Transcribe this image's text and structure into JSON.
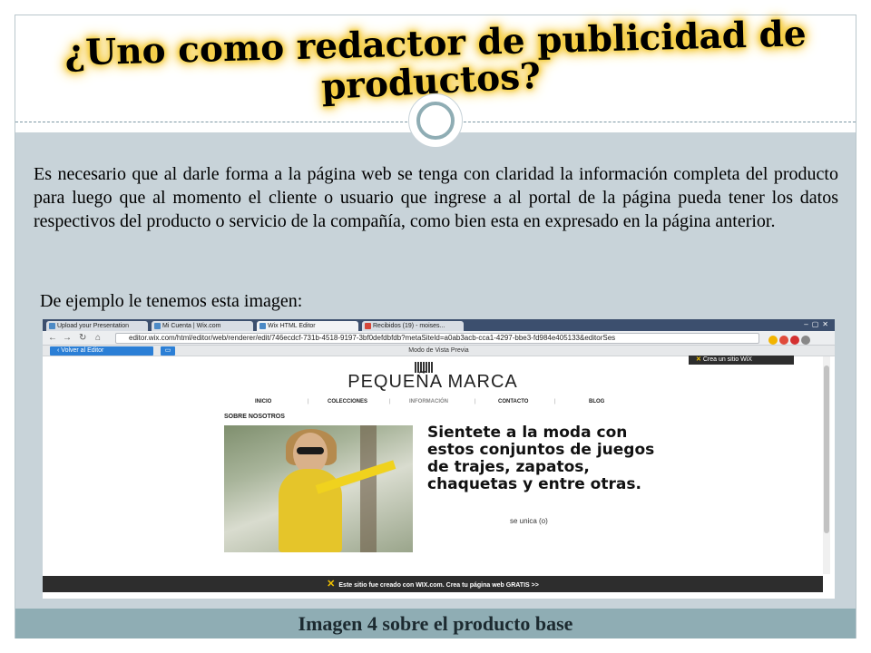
{
  "slide": {
    "title_line1": "¿Uno como redactor de publicidad de",
    "title_line2": "productos?",
    "paragraph": "Es necesario que al darle forma a la página web se tenga con claridad la información completa del producto para luego que al momento el cliente o usuario que ingrese a al portal de la página pueda tener los datos respectivos del producto o servicio de la compañía, como bien esta en expresado en la página anterior.",
    "example_label": "De ejemplo le tenemos esta imagen:",
    "caption": "Imagen 4 sobre el producto base"
  },
  "browser": {
    "tabs": [
      {
        "label": "Upload your Presentation"
      },
      {
        "label": "Mi Cuenta | Wix.com"
      },
      {
        "label": "Wix HTML Editor"
      },
      {
        "label": "Recibidos (19) - moises..."
      }
    ],
    "url": "editor.wix.com/html/editor/web/renderer/edit/746ecdcf-731b-4518-9197-3bf0defdbfdb?metaSiteId=a0ab3acb-cca1-4297-bbe3-fd984e405133&editorSes",
    "back_label": "Volver al Editor",
    "preview_mode": "Modo de Vista Previa",
    "wix_badge": "Crea un sitio WiX",
    "footer": "Este sitio fue creado con WIX.com. Crea tu página web GRATIS >>"
  },
  "site": {
    "brand": "PEQUEÑA MARCA",
    "nav": [
      "INICIO",
      "COLECCIONES",
      "INFORMACIÓN",
      "CONTACTO",
      "BLOG"
    ],
    "about_title": "SOBRE NOSOTROS",
    "promo_text": "Sientete a la moda con estos conjuntos de juegos de trajes, zapatos, chaquetas y entre otras.",
    "promo_sub": "se unica (o)"
  },
  "colors": {
    "content_band": "#c8d3d9",
    "caption_band": "#8fadb4",
    "title_glow": "#f3c324",
    "wix_blue": "#2b7fd6"
  }
}
